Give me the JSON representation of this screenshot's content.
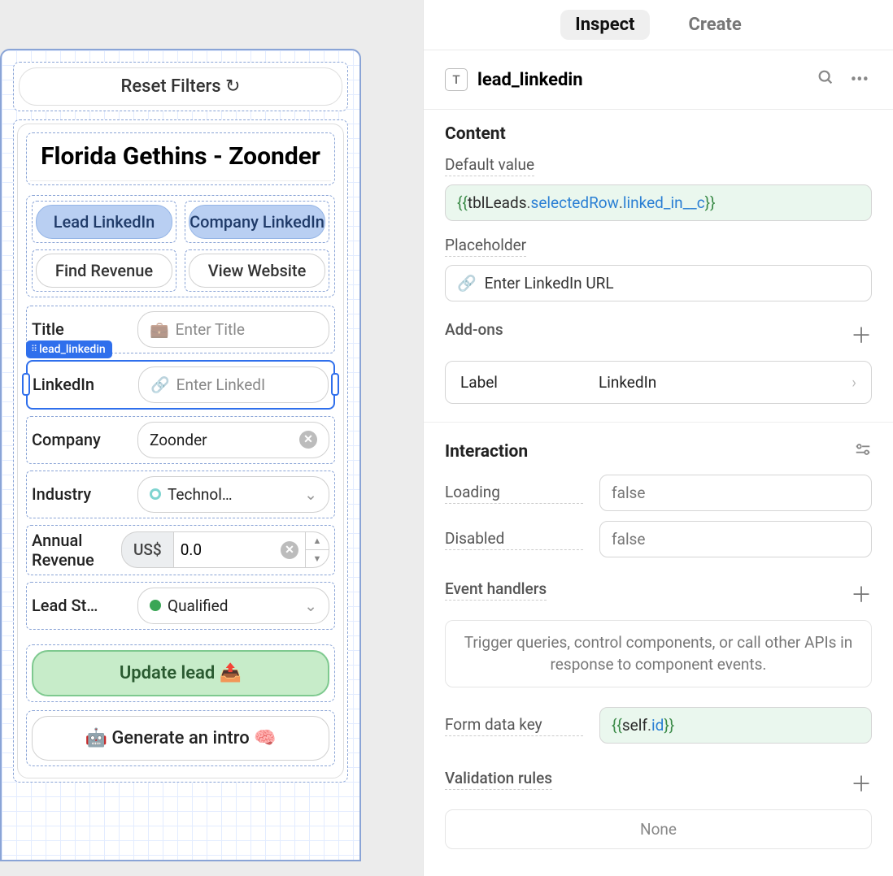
{
  "canvas": {
    "reset_filters_label": "Reset Filters ↻",
    "card_title": "Florida Gethins - Zoonder",
    "btn_lead_linkedin": "Lead LinkedIn",
    "btn_company_linkedin": "Company LinkedIn",
    "btn_find_revenue": "Find Revenue",
    "btn_view_website": "View Website",
    "selected_component_tag": "lead_linkedin",
    "rows": {
      "title": {
        "label": "Title",
        "placeholder": "Enter Title",
        "icon": "💼"
      },
      "linkedin": {
        "label": "LinkedIn",
        "placeholder": "Enter LinkedI",
        "icon": "🔗"
      },
      "company": {
        "label": "Company",
        "value": "Zoonder"
      },
      "industry": {
        "label": "Industry",
        "value": "Technol…"
      },
      "annual": {
        "label": "Annual Revenue",
        "currency": "US$",
        "value": "0.0"
      },
      "lead_status": {
        "label": "Lead St…",
        "value": "Qualified"
      }
    },
    "update_lead_label": "Update lead 📤",
    "generate_intro_label": "🤖 Generate an intro 🧠"
  },
  "inspector": {
    "tab_inspect": "Inspect",
    "tab_create": "Create",
    "component_name": "lead_linkedin",
    "sections": {
      "content_h": "Content",
      "default_value_label": "Default value",
      "default_value_tokens": {
        "open": "{{",
        "close": "}}",
        "a": "tblLeads",
        "b": "selectedRow",
        "c": "linked_in__c"
      },
      "placeholder_label": "Placeholder",
      "placeholder_value": "Enter LinkedIn URL",
      "addons_h": "Add-ons",
      "addon_label_k": "Label",
      "addon_label_v": "LinkedIn",
      "interaction_h": "Interaction",
      "loading_label": "Loading",
      "loading_value": "false",
      "disabled_label": "Disabled",
      "disabled_value": "false",
      "event_handlers_h": "Event handlers",
      "event_handlers_hint": "Trigger queries, control components, or call other APIs in response to component events.",
      "form_data_key_label": "Form data key",
      "form_data_key_tokens": {
        "open": "{{ ",
        "a": "self",
        "b": "id",
        "close": " }}"
      },
      "validation_h": "Validation rules",
      "validation_none": "None"
    }
  }
}
